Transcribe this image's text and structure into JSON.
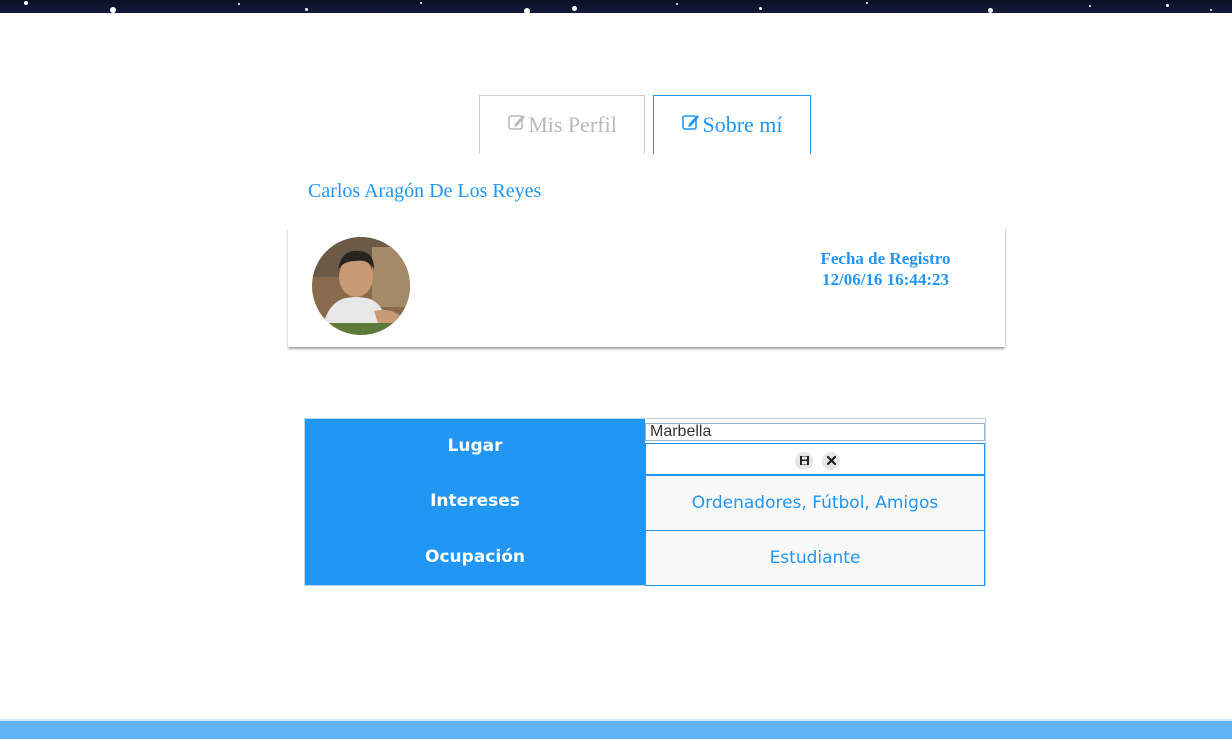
{
  "tabs": {
    "profile_label": "Mis Perfil",
    "about_label": "Sobre mí"
  },
  "user": {
    "name": "Carlos Aragón De Los Reyes",
    "avatar_icon": "user-photo-avatar"
  },
  "registration": {
    "label": "Fecha de Registro",
    "value": "12/06/16 16:44:23"
  },
  "details": {
    "rows": [
      {
        "label": "Lugar",
        "value": "Marbella"
      },
      {
        "label": "Intereses",
        "value": "Ordenadores, Fútbol, Amigos"
      },
      {
        "label": "Ocupación",
        "value": "Estudiante"
      }
    ],
    "save_icon": "floppy-disk-icon",
    "cancel_icon": "close-icon"
  },
  "colors": {
    "accent": "#2196f3",
    "footer": "#5fb3f6",
    "header": "#0a0f26"
  }
}
